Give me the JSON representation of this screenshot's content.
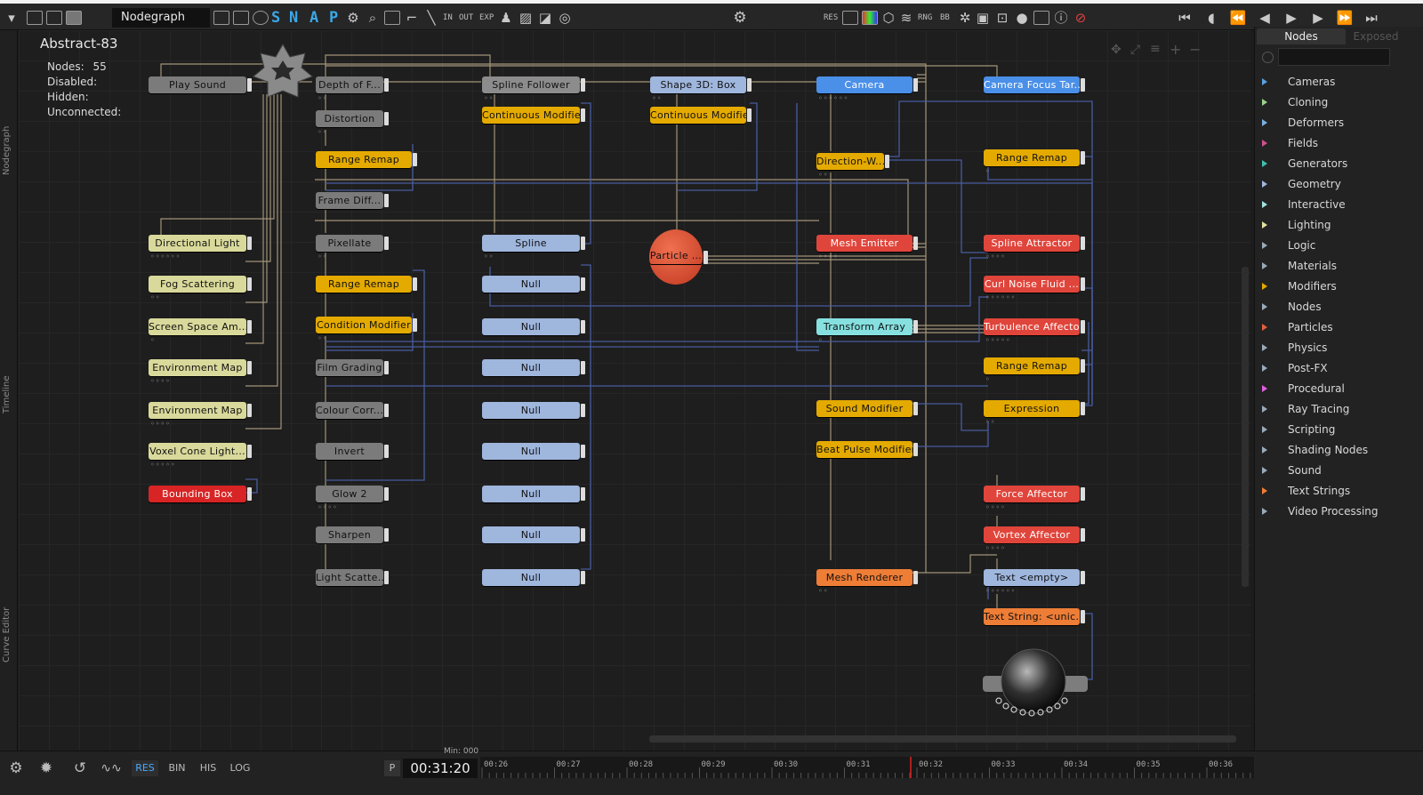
{
  "toolbar": {
    "title": "Nodegraph",
    "snap_letters": [
      "S",
      "N",
      "A",
      "P"
    ],
    "small_labels": [
      "RES",
      "RNG",
      "BB",
      "IN",
      "OUT",
      "EXP"
    ]
  },
  "left_tabs": [
    "Nodegraph",
    "Timeline",
    "Curve Editor"
  ],
  "info": {
    "title": "Abstract-83",
    "nodes_label": "Nodes:",
    "nodes_value": "55",
    "disabled_label": "Disabled:",
    "hidden_label": "Hidden:",
    "unconnected_label": "Unconnected:"
  },
  "nodes": [
    {
      "label": "Play Sound",
      "color": "gray"
    },
    {
      "label": "Depth of F...",
      "color": "gray"
    },
    {
      "label": "Distortion",
      "color": "gray"
    },
    {
      "label": "Range Remap",
      "color": "yellow"
    },
    {
      "label": "Frame Diff...",
      "color": "gray"
    },
    {
      "label": "Pixellate",
      "color": "gray"
    },
    {
      "label": "Range Remap",
      "color": "yellow"
    },
    {
      "label": "Condition Modifier",
      "color": "yellow"
    },
    {
      "label": "Film Grading",
      "color": "gray"
    },
    {
      "label": "Colour Corr...",
      "color": "gray"
    },
    {
      "label": "Invert",
      "color": "gray"
    },
    {
      "label": "Glow 2",
      "color": "gray"
    },
    {
      "label": "Sharpen",
      "color": "gray"
    },
    {
      "label": "Light Scatte...",
      "color": "gray"
    },
    {
      "label": "Directional Light",
      "color": "beige"
    },
    {
      "label": "Fog Scattering",
      "color": "beige"
    },
    {
      "label": "Screen Space Am...",
      "color": "beige"
    },
    {
      "label": "Environment Map",
      "color": "beige"
    },
    {
      "label": "Environment Map",
      "color": "beige"
    },
    {
      "label": "Voxel Cone Light...",
      "color": "beige"
    },
    {
      "label": "Bounding Box",
      "color": "redbright"
    },
    {
      "label": "Spline Follower",
      "color": "lightgray"
    },
    {
      "label": "Continuous Modifier",
      "color": "yellow"
    },
    {
      "label": "Spline",
      "color": "blue"
    },
    {
      "label": "Null",
      "color": "blue"
    },
    {
      "label": "Null",
      "color": "blue"
    },
    {
      "label": "Null",
      "color": "blue"
    },
    {
      "label": "Null",
      "color": "blue"
    },
    {
      "label": "Null",
      "color": "blue"
    },
    {
      "label": "Null",
      "color": "blue"
    },
    {
      "label": "Null",
      "color": "blue"
    },
    {
      "label": "Null",
      "color": "blue"
    },
    {
      "label": "Shape 3D: Box",
      "color": "blue"
    },
    {
      "label": "Continuous Modifier",
      "color": "yellow"
    },
    {
      "label": "Particle ...",
      "color": "orange"
    },
    {
      "label": "Camera",
      "color": "bluebright"
    },
    {
      "label": "Direction-W...",
      "color": "yellow"
    },
    {
      "label": "Mesh Emitter",
      "color": "red"
    },
    {
      "label": "Transform Array",
      "color": "cyan"
    },
    {
      "label": "Sound Modifier",
      "color": "yellow"
    },
    {
      "label": "Beat Pulse Modifier",
      "color": "yellow"
    },
    {
      "label": "Mesh Renderer",
      "color": "orange"
    },
    {
      "label": "Camera Focus Tar...",
      "color": "bluebright"
    },
    {
      "label": "Range Remap",
      "color": "yellow"
    },
    {
      "label": "Spline Attractor",
      "color": "red"
    },
    {
      "label": "Curl Noise Fluid ...",
      "color": "red"
    },
    {
      "label": "Turbulence Affector",
      "color": "red"
    },
    {
      "label": "Range Remap",
      "color": "yellow"
    },
    {
      "label": "Expression",
      "color": "yellow"
    },
    {
      "label": "Force Affector",
      "color": "red"
    },
    {
      "label": "Vortex Affector",
      "color": "red"
    },
    {
      "label": "Text <empty>",
      "color": "blue"
    },
    {
      "label": "Text String: <unic...",
      "color": "orange"
    }
  ],
  "sidebar": {
    "tabs": [
      "Nodes",
      "Exposed"
    ],
    "categories": [
      {
        "label": "Cameras",
        "color": "#5aa0e0"
      },
      {
        "label": "Cloning",
        "color": "#9ad08a"
      },
      {
        "label": "Deformers",
        "color": "#7ab0e0"
      },
      {
        "label": "Fields",
        "color": "#d05090"
      },
      {
        "label": "Generators",
        "color": "#40c0b0"
      },
      {
        "label": "Geometry",
        "color": "#9fb6dd"
      },
      {
        "label": "Interactive",
        "color": "#a0e0e0"
      },
      {
        "label": "Lighting",
        "color": "#e0e0a0"
      },
      {
        "label": "Logic",
        "color": "#9ab"
      },
      {
        "label": "Materials",
        "color": "#9ab"
      },
      {
        "label": "Modifiers",
        "color": "#e4aa00"
      },
      {
        "label": "Nodes",
        "color": "#9ab"
      },
      {
        "label": "Particles",
        "color": "#e06040"
      },
      {
        "label": "Physics",
        "color": "#9ab"
      },
      {
        "label": "Post-FX",
        "color": "#9ab"
      },
      {
        "label": "Procedural",
        "color": "#e060e0"
      },
      {
        "label": "Ray Tracing",
        "color": "#9ab"
      },
      {
        "label": "Scripting",
        "color": "#9ab"
      },
      {
        "label": "Shading Nodes",
        "color": "#9ab"
      },
      {
        "label": "Sound",
        "color": "#9ab"
      },
      {
        "label": "Text Strings",
        "color": "#ee7d36"
      },
      {
        "label": "Video Processing",
        "color": "#9ab"
      }
    ]
  },
  "bottom": {
    "buttons": [
      "RES",
      "BIN",
      "HIS",
      "LOG"
    ],
    "play_label": "P",
    "min_label": "Min: 000",
    "timecode": "00:31:20",
    "ticks": [
      "00:26",
      "00:27",
      "00:28",
      "00:29",
      "00:30",
      "00:31",
      "00:32",
      "00:33",
      "00:34",
      "00:35",
      "00:36"
    ]
  },
  "colors": {
    "accent": "#3aa8e8",
    "playhead": "#e02020",
    "wire_tan": "#b8a888",
    "wire_blue": "#4a5fa8"
  }
}
